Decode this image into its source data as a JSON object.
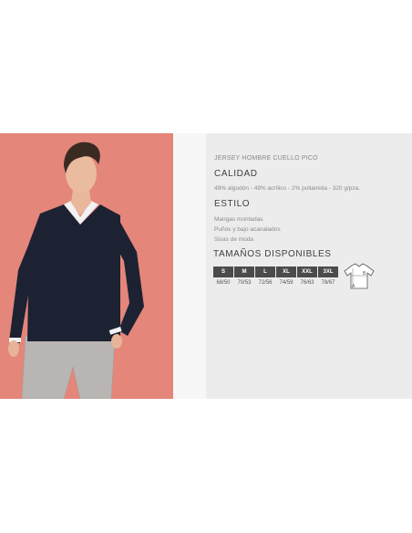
{
  "product": {
    "title": "JERSEY HOMBRE CUELLO PICO"
  },
  "quality": {
    "heading": "CALIDAD",
    "composition": "49% algodón - 49% acrílico - 2% poliamida - 320 g/pza."
  },
  "style": {
    "heading": "ESTILO",
    "features": [
      "Mangas montadas",
      "Puños y bajo acanalados",
      "Sisas de moda"
    ]
  },
  "sizes": {
    "heading": "TAMAÑOS DISPONIBLES",
    "items": [
      {
        "label": "S",
        "measure": "68/50"
      },
      {
        "label": "M",
        "measure": "70/53"
      },
      {
        "label": "L",
        "measure": "72/56"
      },
      {
        "label": "XL",
        "measure": "74/59"
      },
      {
        "label": "XXL",
        "measure": "76/63"
      },
      {
        "label": "3XL",
        "measure": "78/67"
      }
    ],
    "diagram_labels": [
      "A",
      "B"
    ]
  },
  "colors": {
    "photo_background": "#e4867a",
    "sweater": "#1d2233",
    "trousers": "#b9b5b2",
    "size_badge": "#4b4b4b"
  },
  "icons": [
    "measurement-diagram-icon"
  ]
}
